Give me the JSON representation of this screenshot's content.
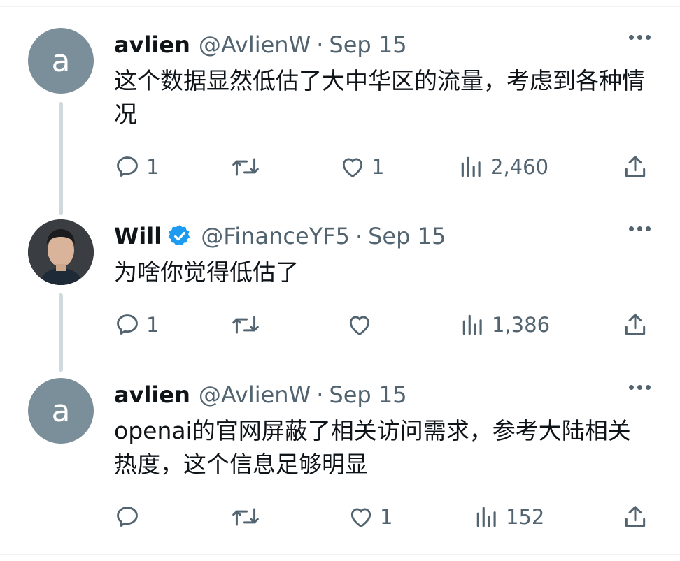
{
  "tweets": [
    {
      "name": "avlien",
      "handle": "@AvlienW",
      "dot": "·",
      "date": "Sep 15",
      "avatar_letter": "a",
      "avatar_color": "#7a8f99",
      "verified": false,
      "text": "这个数据显然低估了大中华区的流量，考虑到各种情况",
      "replies": "1",
      "retweets": "",
      "likes": "1",
      "views": "2,460"
    },
    {
      "name": "Will",
      "handle": "@FinanceYF5",
      "dot": "·",
      "date": "Sep 15",
      "avatar_letter": "",
      "verified": true,
      "verified_color": "#1d9bf0",
      "text": "为啥你觉得低估了",
      "replies": "1",
      "retweets": "",
      "likes": "",
      "views": "1,386"
    },
    {
      "name": "avlien",
      "handle": "@AvlienW",
      "dot": "·",
      "date": "Sep 15",
      "avatar_letter": "a",
      "avatar_color": "#7a8f99",
      "verified": false,
      "text": "openai的官网屏蔽了相关访问需求，参考大陆相关热度，这个信息足够明显",
      "replies": "",
      "retweets": "",
      "likes": "1",
      "views": "152"
    }
  ],
  "icons": {
    "reply": "reply-icon",
    "retweet": "retweet-icon",
    "like": "heart-icon",
    "views": "views-icon",
    "share": "share-icon",
    "more": "more-icon"
  }
}
